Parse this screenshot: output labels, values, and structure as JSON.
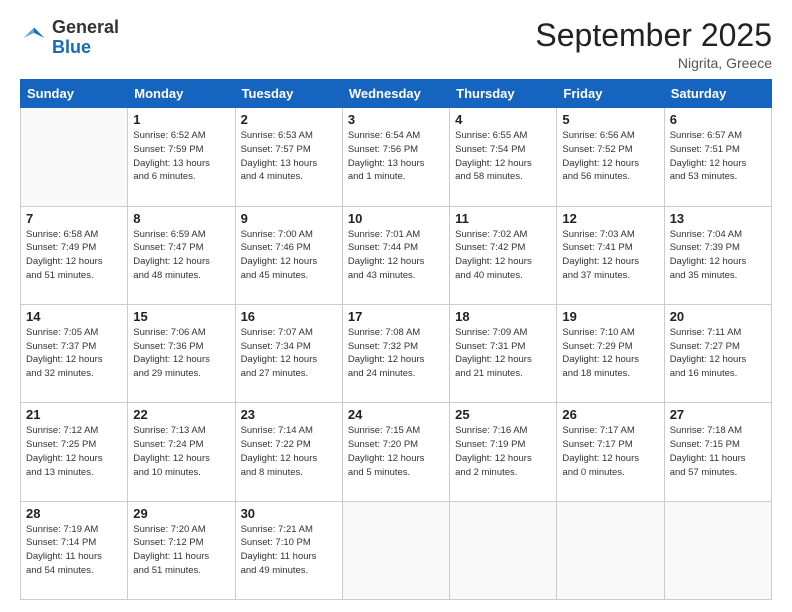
{
  "header": {
    "logo_general": "General",
    "logo_blue": "Blue",
    "month_title": "September 2025",
    "location": "Nigrita, Greece"
  },
  "days_of_week": [
    "Sunday",
    "Monday",
    "Tuesday",
    "Wednesday",
    "Thursday",
    "Friday",
    "Saturday"
  ],
  "weeks": [
    [
      {
        "num": "",
        "info": ""
      },
      {
        "num": "1",
        "info": "Sunrise: 6:52 AM\nSunset: 7:59 PM\nDaylight: 13 hours\nand 6 minutes."
      },
      {
        "num": "2",
        "info": "Sunrise: 6:53 AM\nSunset: 7:57 PM\nDaylight: 13 hours\nand 4 minutes."
      },
      {
        "num": "3",
        "info": "Sunrise: 6:54 AM\nSunset: 7:56 PM\nDaylight: 13 hours\nand 1 minute."
      },
      {
        "num": "4",
        "info": "Sunrise: 6:55 AM\nSunset: 7:54 PM\nDaylight: 12 hours\nand 58 minutes."
      },
      {
        "num": "5",
        "info": "Sunrise: 6:56 AM\nSunset: 7:52 PM\nDaylight: 12 hours\nand 56 minutes."
      },
      {
        "num": "6",
        "info": "Sunrise: 6:57 AM\nSunset: 7:51 PM\nDaylight: 12 hours\nand 53 minutes."
      }
    ],
    [
      {
        "num": "7",
        "info": "Sunrise: 6:58 AM\nSunset: 7:49 PM\nDaylight: 12 hours\nand 51 minutes."
      },
      {
        "num": "8",
        "info": "Sunrise: 6:59 AM\nSunset: 7:47 PM\nDaylight: 12 hours\nand 48 minutes."
      },
      {
        "num": "9",
        "info": "Sunrise: 7:00 AM\nSunset: 7:46 PM\nDaylight: 12 hours\nand 45 minutes."
      },
      {
        "num": "10",
        "info": "Sunrise: 7:01 AM\nSunset: 7:44 PM\nDaylight: 12 hours\nand 43 minutes."
      },
      {
        "num": "11",
        "info": "Sunrise: 7:02 AM\nSunset: 7:42 PM\nDaylight: 12 hours\nand 40 minutes."
      },
      {
        "num": "12",
        "info": "Sunrise: 7:03 AM\nSunset: 7:41 PM\nDaylight: 12 hours\nand 37 minutes."
      },
      {
        "num": "13",
        "info": "Sunrise: 7:04 AM\nSunset: 7:39 PM\nDaylight: 12 hours\nand 35 minutes."
      }
    ],
    [
      {
        "num": "14",
        "info": "Sunrise: 7:05 AM\nSunset: 7:37 PM\nDaylight: 12 hours\nand 32 minutes."
      },
      {
        "num": "15",
        "info": "Sunrise: 7:06 AM\nSunset: 7:36 PM\nDaylight: 12 hours\nand 29 minutes."
      },
      {
        "num": "16",
        "info": "Sunrise: 7:07 AM\nSunset: 7:34 PM\nDaylight: 12 hours\nand 27 minutes."
      },
      {
        "num": "17",
        "info": "Sunrise: 7:08 AM\nSunset: 7:32 PM\nDaylight: 12 hours\nand 24 minutes."
      },
      {
        "num": "18",
        "info": "Sunrise: 7:09 AM\nSunset: 7:31 PM\nDaylight: 12 hours\nand 21 minutes."
      },
      {
        "num": "19",
        "info": "Sunrise: 7:10 AM\nSunset: 7:29 PM\nDaylight: 12 hours\nand 18 minutes."
      },
      {
        "num": "20",
        "info": "Sunrise: 7:11 AM\nSunset: 7:27 PM\nDaylight: 12 hours\nand 16 minutes."
      }
    ],
    [
      {
        "num": "21",
        "info": "Sunrise: 7:12 AM\nSunset: 7:25 PM\nDaylight: 12 hours\nand 13 minutes."
      },
      {
        "num": "22",
        "info": "Sunrise: 7:13 AM\nSunset: 7:24 PM\nDaylight: 12 hours\nand 10 minutes."
      },
      {
        "num": "23",
        "info": "Sunrise: 7:14 AM\nSunset: 7:22 PM\nDaylight: 12 hours\nand 8 minutes."
      },
      {
        "num": "24",
        "info": "Sunrise: 7:15 AM\nSunset: 7:20 PM\nDaylight: 12 hours\nand 5 minutes."
      },
      {
        "num": "25",
        "info": "Sunrise: 7:16 AM\nSunset: 7:19 PM\nDaylight: 12 hours\nand 2 minutes."
      },
      {
        "num": "26",
        "info": "Sunrise: 7:17 AM\nSunset: 7:17 PM\nDaylight: 12 hours\nand 0 minutes."
      },
      {
        "num": "27",
        "info": "Sunrise: 7:18 AM\nSunset: 7:15 PM\nDaylight: 11 hours\nand 57 minutes."
      }
    ],
    [
      {
        "num": "28",
        "info": "Sunrise: 7:19 AM\nSunset: 7:14 PM\nDaylight: 11 hours\nand 54 minutes."
      },
      {
        "num": "29",
        "info": "Sunrise: 7:20 AM\nSunset: 7:12 PM\nDaylight: 11 hours\nand 51 minutes."
      },
      {
        "num": "30",
        "info": "Sunrise: 7:21 AM\nSunset: 7:10 PM\nDaylight: 11 hours\nand 49 minutes."
      },
      {
        "num": "",
        "info": ""
      },
      {
        "num": "",
        "info": ""
      },
      {
        "num": "",
        "info": ""
      },
      {
        "num": "",
        "info": ""
      }
    ]
  ]
}
